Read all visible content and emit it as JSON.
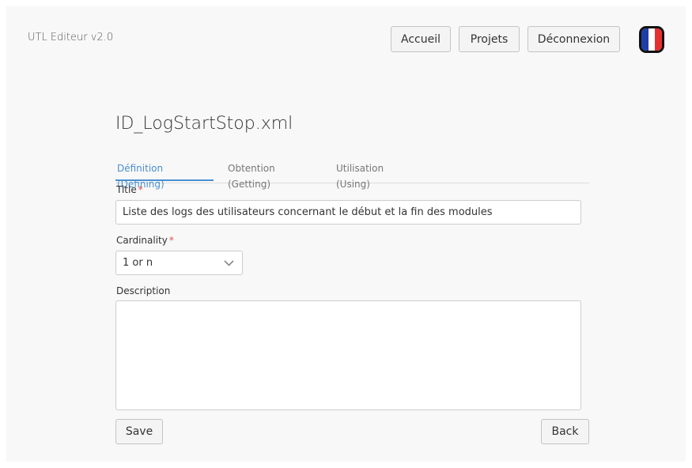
{
  "header": {
    "app_title": "UTL Editeur v2.0",
    "nav": {
      "accueil": "Accueil",
      "projets": "Projets",
      "deconnexion": "Déconnexion"
    },
    "language_flag": {
      "icon": "france-flag-icon",
      "colors": [
        "#1f3fa8",
        "#ffffff",
        "#e53030"
      ]
    }
  },
  "document": {
    "title": "ID_LogStartStop.xml"
  },
  "tabs": [
    {
      "label": "Définition (Defining)",
      "active": true
    },
    {
      "label": "Obtention (Getting)",
      "active": false
    },
    {
      "label": "Utilisation (Using)",
      "active": false
    }
  ],
  "form": {
    "title_label": "Title",
    "required_marker": "*",
    "title_value": "Liste des logs des utilisateurs concernant le début et la fin des modules",
    "cardinality_label": "Cardinality",
    "cardinality_value": "1 or n",
    "description_label": "Description",
    "description_value": ""
  },
  "actions": {
    "save": "Save",
    "back": "Back"
  },
  "colors": {
    "accent": "#4a8fd0",
    "required": "#d9534f",
    "background": "#f8f8f8"
  }
}
